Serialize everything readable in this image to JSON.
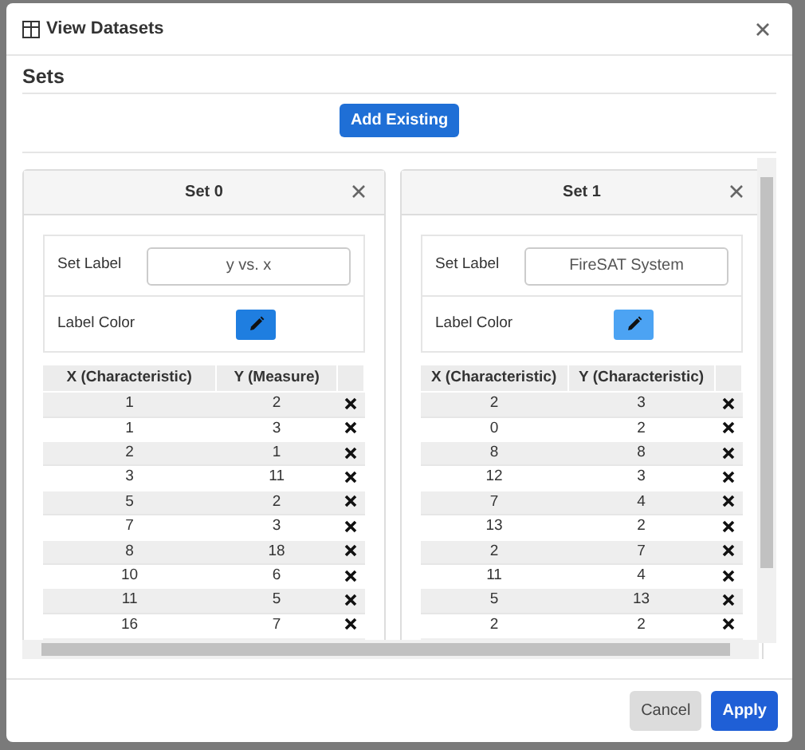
{
  "dialog": {
    "title": "View Datasets"
  },
  "section": {
    "heading": "Sets",
    "add_button": "Add Existing"
  },
  "sets": [
    {
      "title": "Set 0",
      "label_caption": "Set Label",
      "label_value": "y vs. x",
      "color_caption": "Label Color",
      "color": "#1f7ee0",
      "columns": [
        "X (Characteristic)",
        "Y (Measure)"
      ],
      "rows": [
        [
          "1",
          "2"
        ],
        [
          "1",
          "3"
        ],
        [
          "2",
          "1"
        ],
        [
          "3",
          "11"
        ],
        [
          "5",
          "2"
        ],
        [
          "7",
          "3"
        ],
        [
          "8",
          "18"
        ],
        [
          "10",
          "6"
        ],
        [
          "11",
          "5"
        ],
        [
          "16",
          "7"
        ]
      ]
    },
    {
      "title": "Set 1",
      "label_caption": "Set Label",
      "label_value": "FireSAT System",
      "color_caption": "Label Color",
      "color": "#4ca3f3",
      "columns": [
        "X (Characteristic)",
        "Y (Characteristic)"
      ],
      "rows": [
        [
          "2",
          "3"
        ],
        [
          "0",
          "2"
        ],
        [
          "8",
          "8"
        ],
        [
          "12",
          "3"
        ],
        [
          "7",
          "4"
        ],
        [
          "13",
          "2"
        ],
        [
          "2",
          "7"
        ],
        [
          "11",
          "4"
        ],
        [
          "5",
          "13"
        ],
        [
          "2",
          "2"
        ]
      ]
    }
  ],
  "footer": {
    "buttons": [
      {
        "label": "Cancel",
        "kind": "secondary"
      },
      {
        "label": "Apply",
        "kind": "primary"
      }
    ]
  }
}
